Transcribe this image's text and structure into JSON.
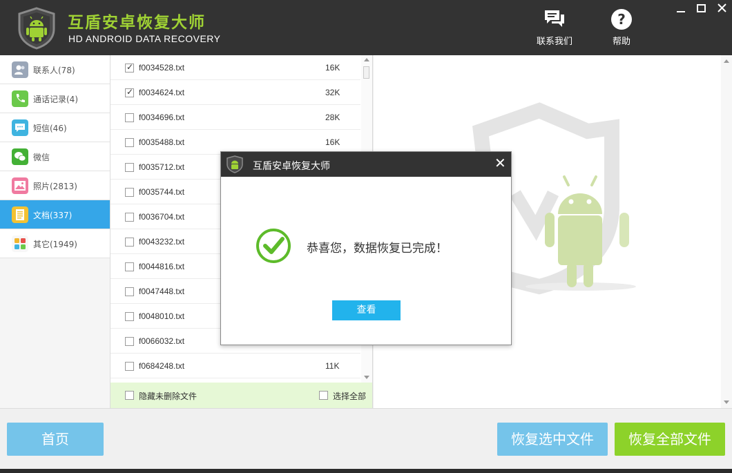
{
  "header": {
    "title": "互盾安卓恢复大师",
    "subtitle": "HD ANDROID DATA RECOVERY",
    "contact_label": "联系我们",
    "help_label": "帮助"
  },
  "sidebar": {
    "items": [
      {
        "label": "联系人(78)",
        "icon": "contacts-icon",
        "color": "#9aa6b8"
      },
      {
        "label": "通话记录(4)",
        "icon": "phone-icon",
        "color": "#6bc94a"
      },
      {
        "label": "短信(46)",
        "icon": "sms-icon",
        "color": "#3fb4e0"
      },
      {
        "label": "微信",
        "icon": "wechat-icon",
        "color": "#43b035"
      },
      {
        "label": "照片(2813)",
        "icon": "photo-icon",
        "color": "#f07aa0"
      },
      {
        "label": "文档(337)",
        "icon": "document-icon",
        "color": "#f3c233"
      },
      {
        "label": "其它(1949)",
        "icon": "other-apps-icon",
        "color": "#f0f0f0"
      }
    ],
    "active_index": 5
  },
  "files": [
    {
      "name": "f0034528.txt",
      "size": "16K",
      "checked": true
    },
    {
      "name": "f0034624.txt",
      "size": "32K",
      "checked": true
    },
    {
      "name": "f0034696.txt",
      "size": "28K",
      "checked": false
    },
    {
      "name": "f0035488.txt",
      "size": "16K",
      "checked": false
    },
    {
      "name": "f0035712.txt",
      "size": "",
      "checked": false
    },
    {
      "name": "f0035744.txt",
      "size": "",
      "checked": false
    },
    {
      "name": "f0036704.txt",
      "size": "",
      "checked": false
    },
    {
      "name": "f0043232.txt",
      "size": "",
      "checked": false
    },
    {
      "name": "f0044816.txt",
      "size": "",
      "checked": false
    },
    {
      "name": "f0047448.txt",
      "size": "",
      "checked": false
    },
    {
      "name": "f0048010.txt",
      "size": "",
      "checked": false
    },
    {
      "name": "f0066032.txt",
      "size": "",
      "checked": false
    },
    {
      "name": "f0684248.txt",
      "size": "11K",
      "checked": false
    }
  ],
  "list_footer": {
    "hide_undeleted_label": "隐藏未删除文件",
    "select_all_label": "选择全部"
  },
  "bottom": {
    "home_label": "首页",
    "recover_selected_label": "恢复选中文件",
    "recover_all_label": "恢复全部文件"
  },
  "dialog": {
    "title": "互盾安卓恢复大师",
    "message": "恭喜您，数据恢复已完成！",
    "button_label": "查看"
  },
  "colors": {
    "header_bg": "#333333",
    "brand_green": "#9fd134",
    "active_blue": "#35a6e8",
    "button_blue": "#75c4ea",
    "button_green": "#8dd22a",
    "dialog_button": "#22b3ec"
  }
}
